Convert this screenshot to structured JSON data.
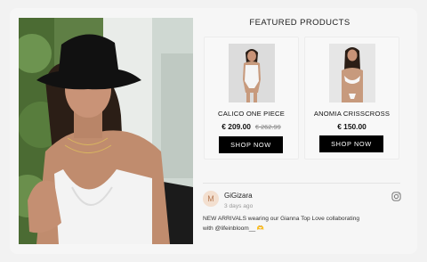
{
  "section": {
    "title": "FEATURED PRODUCTS"
  },
  "products": [
    {
      "name": "CALICO ONE PIECE",
      "price": "€ 209.00",
      "old_price": "€ 262.99",
      "button": "SHOP NOW"
    },
    {
      "name": "ANOMIA CRISSCROSS",
      "price": "€ 150.00",
      "old_price": "",
      "button": "SHOP NOW"
    }
  ],
  "post": {
    "avatar_initial": "M",
    "username": "GiGizara",
    "timestamp": "3 days ago",
    "caption_line1": "NEW ARRIVALS wearing our Gianna Top Love collaborating",
    "caption_line2": "with @lifeinbloom__ 🫶"
  },
  "icons": {
    "social": "instagram-icon"
  },
  "colors": {
    "button_bg": "#000000",
    "background": "#f2f2f2"
  }
}
